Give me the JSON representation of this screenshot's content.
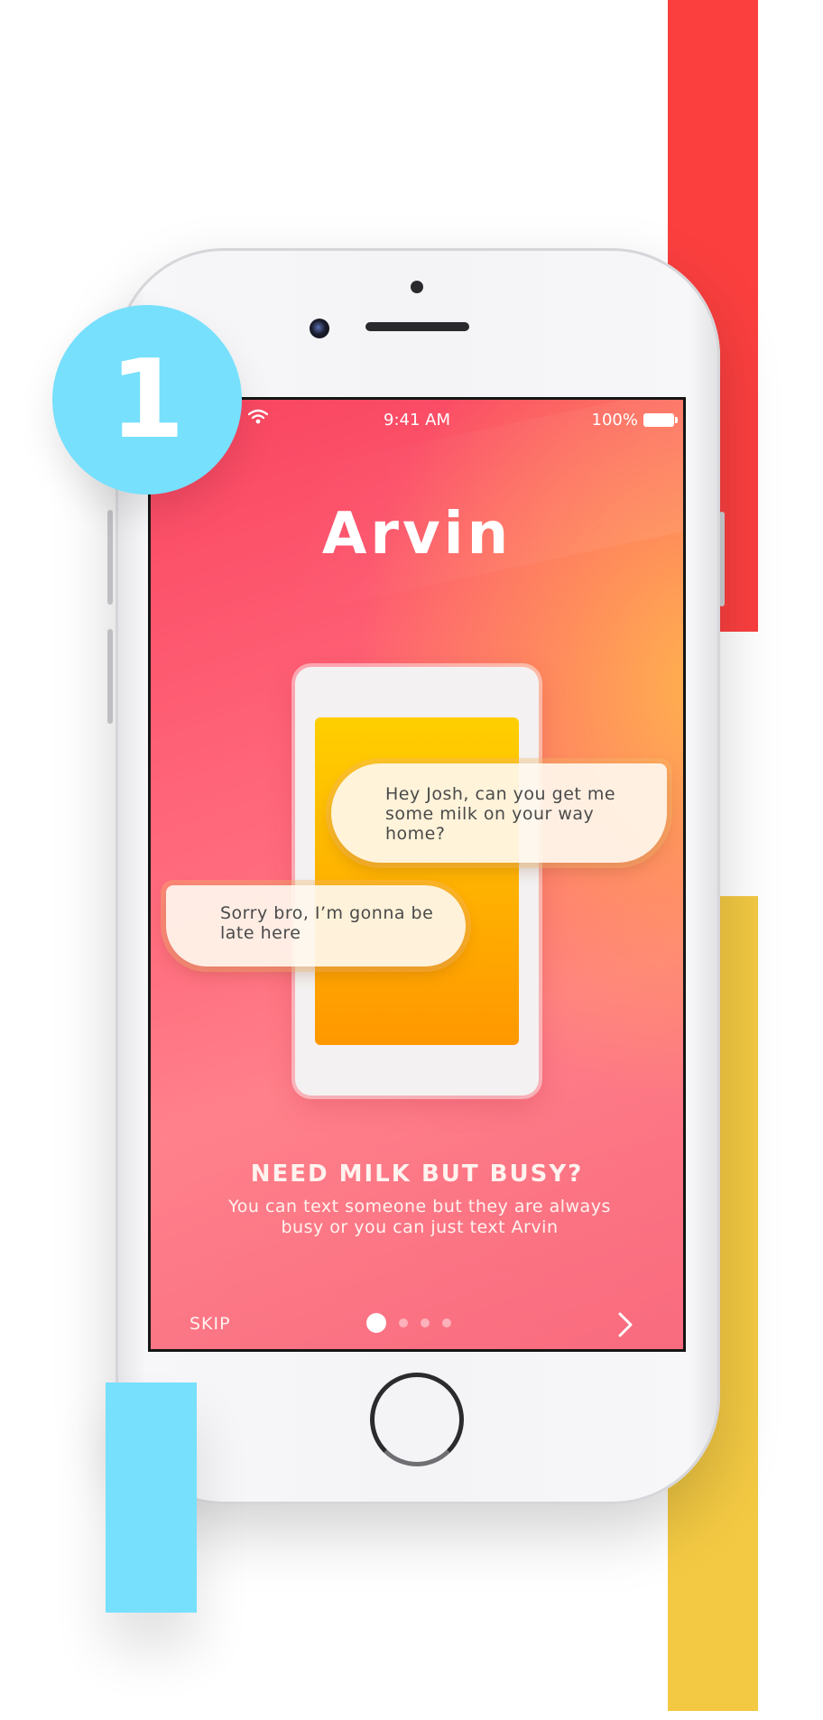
{
  "step": {
    "number": "1"
  },
  "status_bar": {
    "time": "9:41 AM",
    "battery": "100%",
    "wifi_icon": "wifi-icon",
    "battery_icon": "battery-icon"
  },
  "brand": {
    "logo_text": "Arvin"
  },
  "chat": {
    "incoming": "Hey Josh, can you get me some milk on your way home?",
    "outgoing": "Sorry bro, I’m gonna be late here"
  },
  "onboarding": {
    "headline": "NEED MILK BUT BUSY?",
    "description": "You can text someone but they are always busy or you can just text Arvin"
  },
  "controls": {
    "skip_label": "SKIP",
    "next_icon": "chevron-right-icon",
    "page_count": 4,
    "active_page": 1
  },
  "colors": {
    "accent_red": "#fb3f3f",
    "accent_yellow": "#f3c943",
    "accent_blue": "#77e0fd",
    "screen_gradient_start": "#f9445f",
    "screen_gradient_end": "#ff7c87"
  }
}
